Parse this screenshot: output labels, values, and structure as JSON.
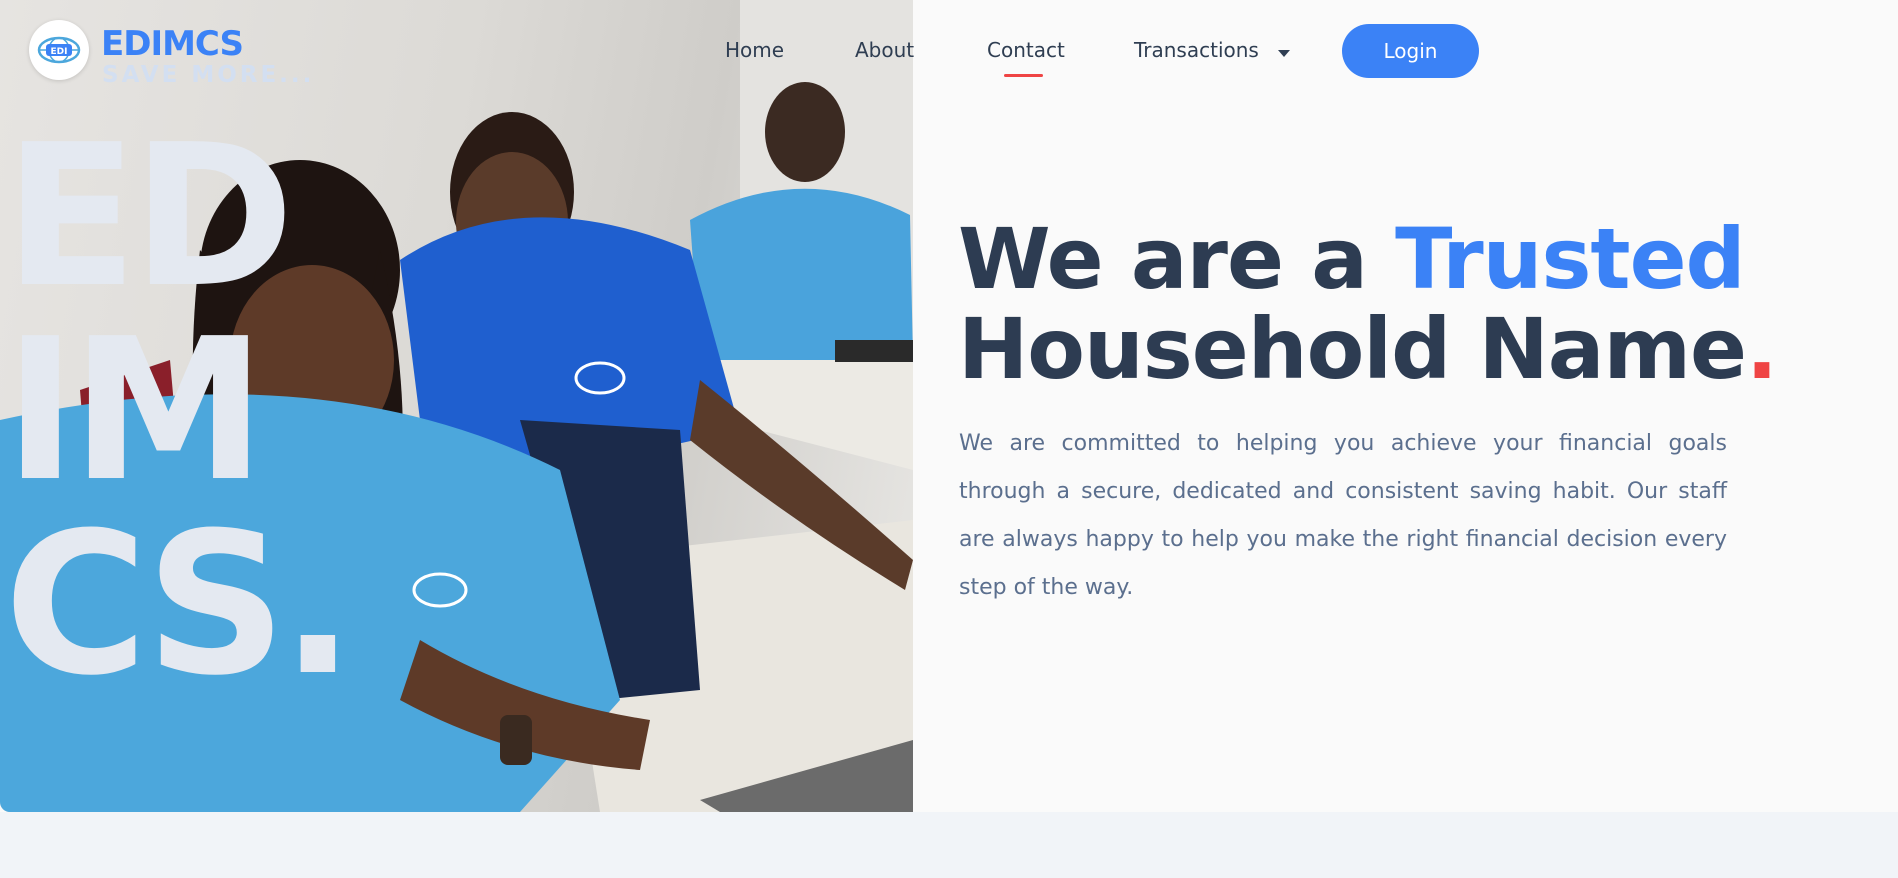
{
  "brand": {
    "name": "EDIMCS",
    "tagline": "SAVE MORE...",
    "logo_text": "EDI"
  },
  "nav": {
    "items": [
      {
        "label": "Home"
      },
      {
        "label": "About"
      },
      {
        "label": "Contact"
      },
      {
        "label": "Transactions"
      }
    ],
    "active": "Contact",
    "login_label": "Login"
  },
  "hero": {
    "big_text": [
      "ED",
      "IM",
      "CS."
    ],
    "headline_part1": "We are a ",
    "headline_accent": "Trusted",
    "headline_line2": "Household Name",
    "headline_dot": ".",
    "description": "We are committed to helping you achieve your financial goals through a secure, dedicated and consistent saving habit. Our staff are always happy to help you make the right financial decision every step of the way."
  },
  "colors": {
    "brand_blue": "#3b82f6",
    "heading": "#2d3c52",
    "accent_red": "#ef4444",
    "body_text": "#5b6f8e"
  }
}
